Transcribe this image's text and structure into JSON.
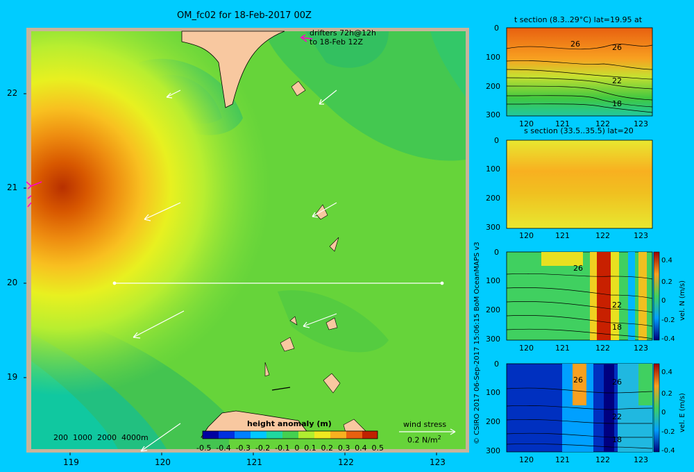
{
  "title": "OM_fc02 for 18-Feb-2017 00Z",
  "drifters_note": [
    "drifters 72h@12h",
    "to 18-Feb 12Z"
  ],
  "map": {
    "x_ticks": [
      "119",
      "120",
      "121",
      "122",
      "123"
    ],
    "y_ticks": [
      "22",
      "21",
      "20",
      "19"
    ],
    "bathy_legend": "200  1000  2000  4000m",
    "wind_stress_label": "wind stress",
    "wind_stress_value": "0.2 N/m",
    "wind_stress_exp": "2"
  },
  "colorbar": {
    "title": "height anomaly  (m)",
    "labels": [
      "-0.5",
      "-0.4",
      "-0.3",
      "-0.2",
      "-0.1",
      "0",
      "0.1",
      "0.2",
      "0.3",
      "0.4",
      "0.5"
    ]
  },
  "credit": "© CSIRO 2017   06-Sep-2017 15:06:15 BoM OceanMAPS v3",
  "sections": [
    {
      "title": "t section (8.3..29°C) lat=19.95 at",
      "y_ticks": [
        "0",
        "100",
        "200",
        "300"
      ],
      "x_ticks": [
        "120",
        "121",
        "122",
        "123"
      ],
      "contour_labels": [
        "26",
        "26",
        "22",
        "18"
      ]
    },
    {
      "title": "s section (33.5..35.5) lat=20",
      "y_ticks": [
        "0",
        "100",
        "200",
        "300"
      ],
      "x_ticks": [
        "120",
        "121",
        "122",
        "123"
      ],
      "contour_labels": []
    },
    {
      "title": "",
      "y_ticks": [
        "0",
        "100",
        "200",
        "300"
      ],
      "x_ticks": [
        "120",
        "121",
        "122",
        "123"
      ],
      "contour_labels": [
        "26",
        "22",
        "18"
      ],
      "cbar_labels": [
        "0.4",
        "0.2",
        "0",
        "-0.2",
        "-0.4"
      ],
      "cbar_title": "vel. N (m/s)"
    },
    {
      "title": "",
      "y_ticks": [
        "0",
        "100",
        "200",
        "300"
      ],
      "x_ticks": [
        "120",
        "121",
        "122",
        "123"
      ],
      "contour_labels": [
        "26",
        "26",
        "22",
        "18"
      ],
      "cbar_labels": [
        "0.4",
        "0.2",
        "0",
        "-0.2",
        "-0.4"
      ],
      "cbar_title": "vel. E (m/s)"
    }
  ]
}
